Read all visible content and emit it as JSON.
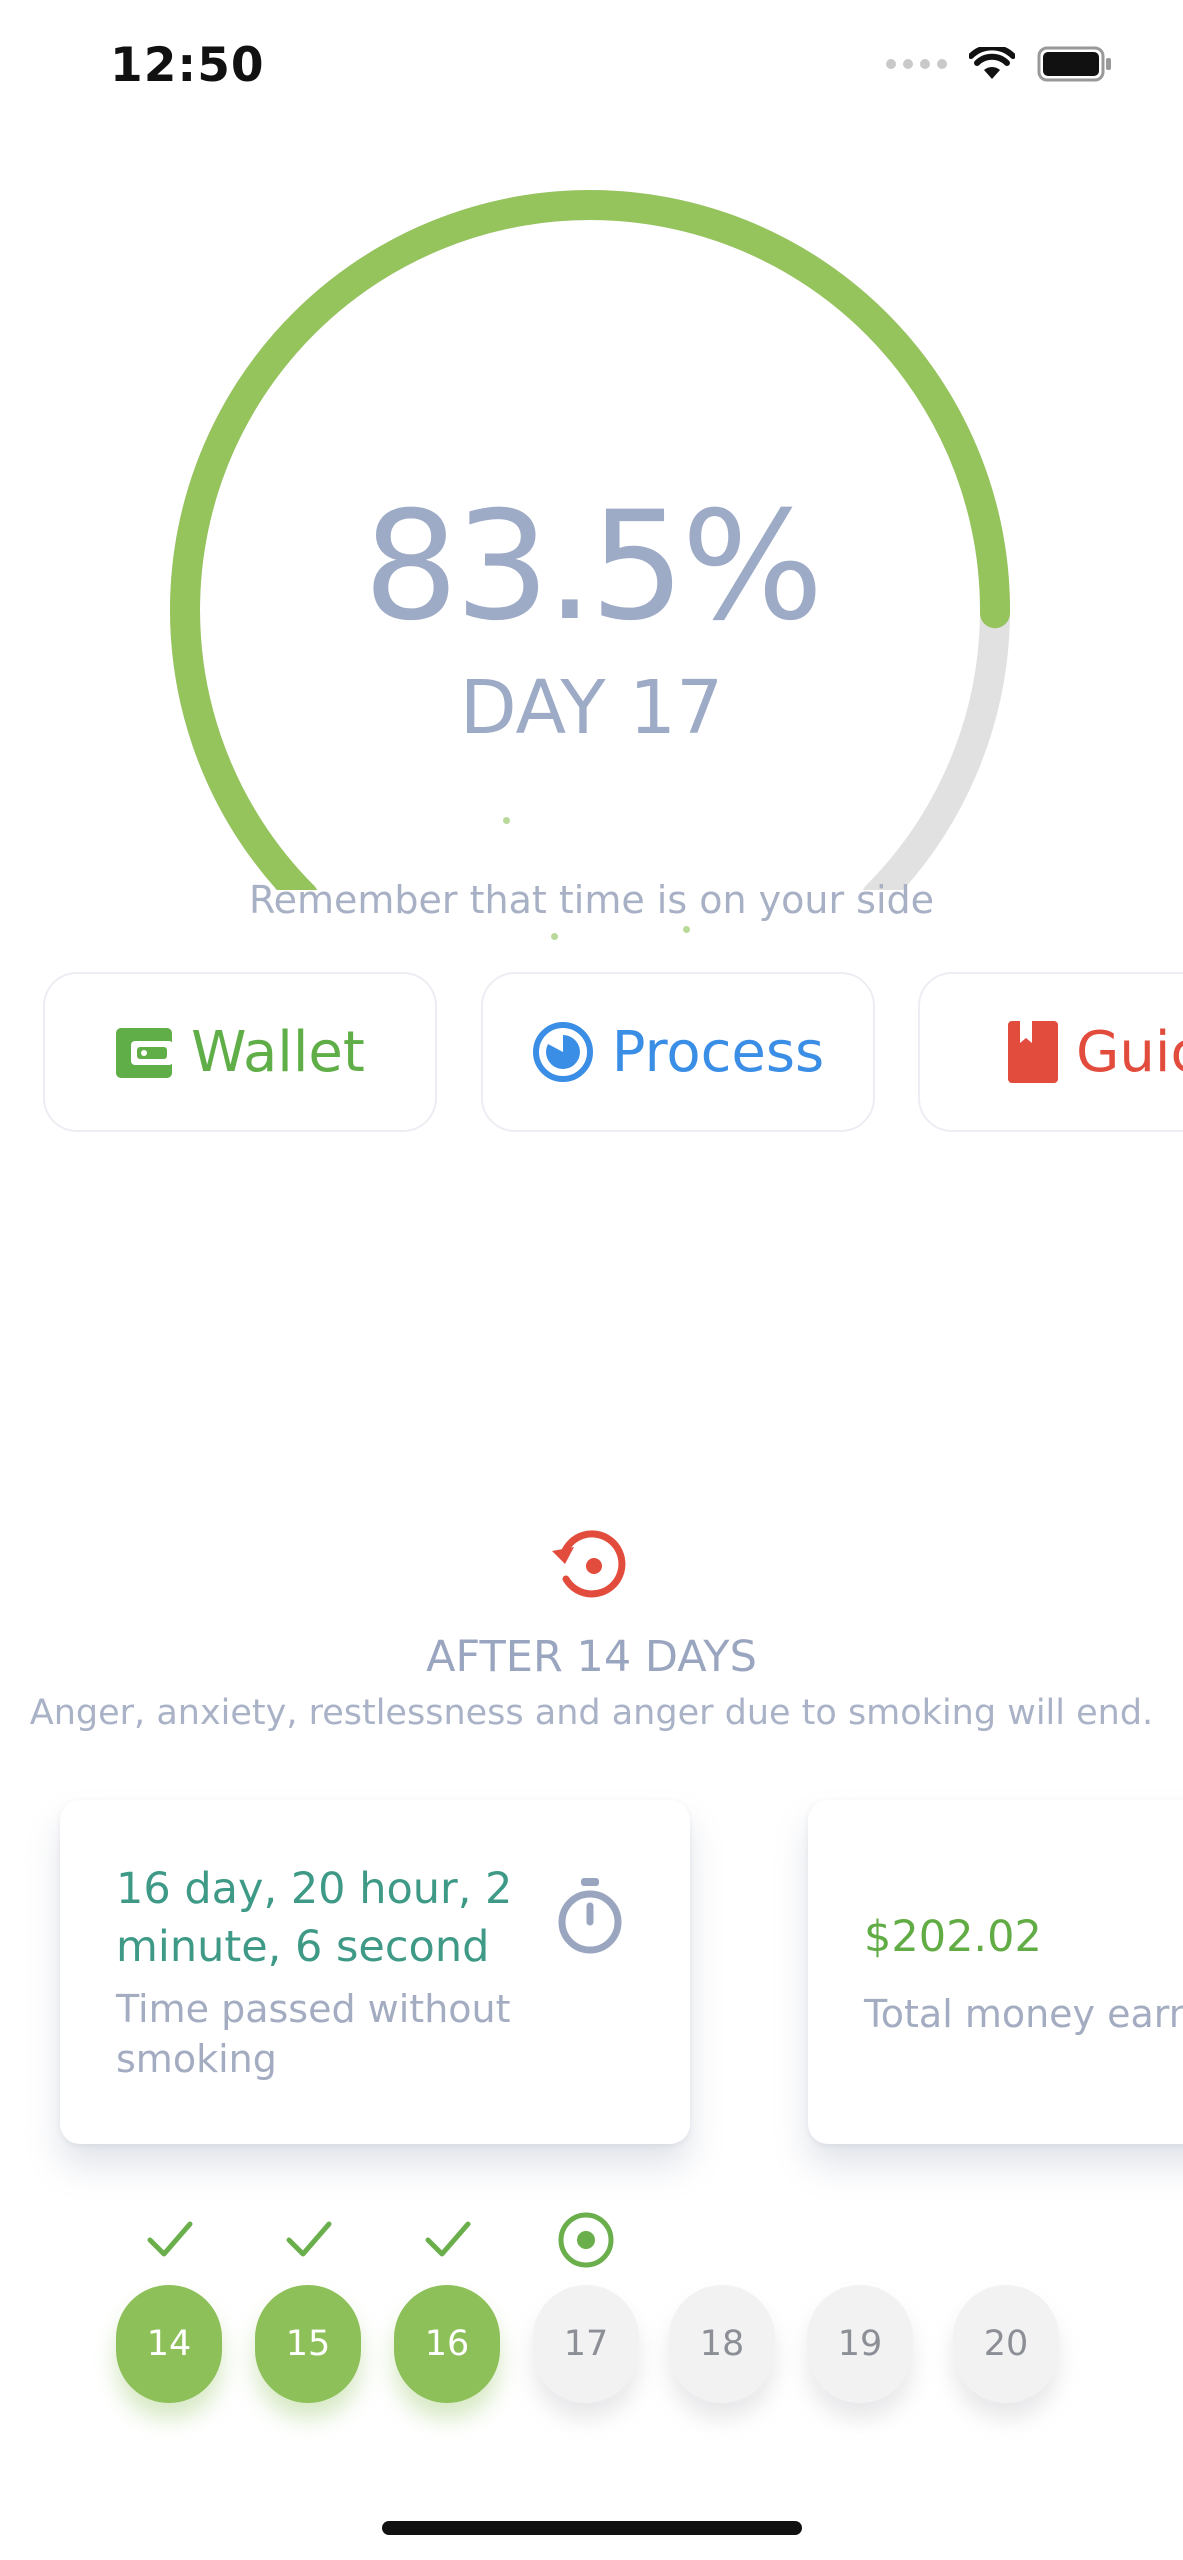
{
  "status_bar": {
    "time": "12:50"
  },
  "gauge": {
    "percent_text": "83.5%",
    "progress": 0.835,
    "day_text": "DAY 17",
    "track_color": "#e1e1e1",
    "fill_color": "#95c35c"
  },
  "tagline": "Remember that time is on your side",
  "quick_buttons": [
    {
      "label": "Wallet",
      "icon": "wallet-icon",
      "color": "#5fae47"
    },
    {
      "label": "Process",
      "icon": "pie-progress-icon",
      "color": "#3b8ee6"
    },
    {
      "label": "Guic",
      "icon": "bookmark-book-icon",
      "color": "#e24c3d"
    }
  ],
  "milestone": {
    "icon": "restore-icon",
    "title": "AFTER 14 DAYS",
    "description": "Anger, anxiety, restlessness and anger due to smoking will end."
  },
  "cards": [
    {
      "value": "16 day, 20 hour, 2 minute, 6 second",
      "label": "Time passed without smoking",
      "icon": "stopwatch-icon"
    },
    {
      "value": "$202.02",
      "label": "Total money earn"
    }
  ],
  "days": [
    {
      "number": "14",
      "status": "done"
    },
    {
      "number": "15",
      "status": "done"
    },
    {
      "number": "16",
      "status": "done"
    },
    {
      "number": "17",
      "status": "current"
    },
    {
      "number": "18",
      "status": "upcoming"
    },
    {
      "number": "19",
      "status": "upcoming"
    },
    {
      "number": "20",
      "status": "upcoming"
    }
  ]
}
